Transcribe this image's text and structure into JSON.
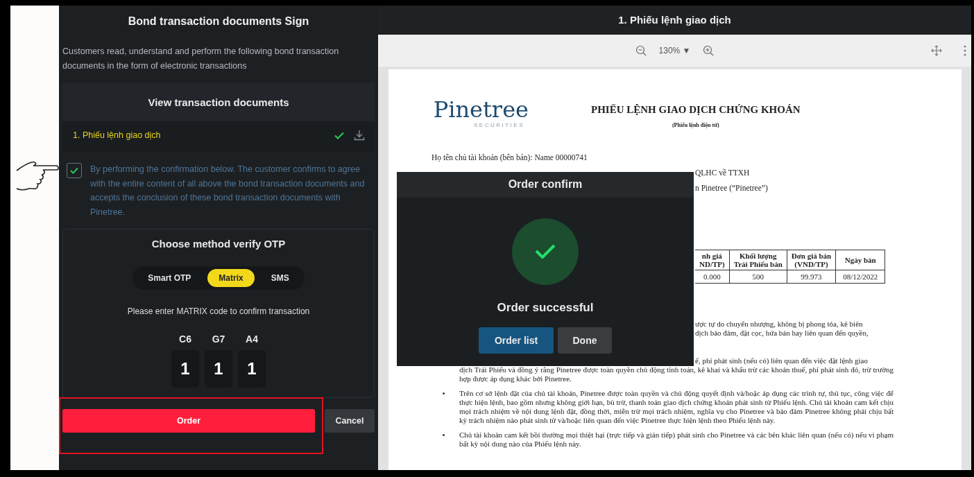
{
  "left_panel": {
    "title": "Bond transaction documents Sign",
    "description": "Customers read, understand and perform the following bond transaction documents in the form of electronic transactions",
    "documents": {
      "title": "View transaction documents",
      "items": [
        {
          "label": "1. Phiếu lệnh giao dịch",
          "signed": true
        }
      ]
    },
    "agreement": {
      "checked": true,
      "text": "By performing the confirmation below. The customer confirms to agree with the entire content of all above the bond transaction documents and accepts the conclusion of these bond transaction documents with Pinetree."
    },
    "otp": {
      "title": "Choose method verify OTP",
      "methods": [
        {
          "label": "Smart OTP",
          "selected": false
        },
        {
          "label": "Matrix",
          "selected": true
        },
        {
          "label": "SMS",
          "selected": false
        }
      ],
      "instruction": "Please enter MATRIX code to confirm transaction",
      "matrix": [
        {
          "code": "C6",
          "value": "1"
        },
        {
          "code": "G7",
          "value": "1"
        },
        {
          "code": "A4",
          "value": "1"
        }
      ]
    },
    "buttons": [
      {
        "label": "Order",
        "kind": "primary"
      },
      {
        "label": "Cancel",
        "kind": "secondary"
      }
    ]
  },
  "viewer": {
    "title": "1. Phiếu lệnh giao dịch",
    "zoom": "130% ▼",
    "document": {
      "logo": "Pinetree",
      "logo_sub": "SECURITIES",
      "heading": "PHIẾU LỆNH GIAO DỊCH CHỨNG KHOÁN",
      "subheading": "(Phiếu lệnh điện tử)",
      "owner_line": "Họ tên chủ tài khoản (bên bán): Name 00000741",
      "top_fragments": [
        "QLHC về TTXH",
        "n Pinetree (“Pinetree”)"
      ],
      "table": {
        "columns": [
          "nh giá\nND/TP)",
          "Khối lượng\nTrái Phiếu bán",
          "Đơn giá bán\n(VND/TP)",
          "Ngày bán"
        ],
        "rows": [
          [
            "0.000",
            "500",
            "99.973",
            "08/12/2022"
          ]
        ]
      },
      "fragments": [
        [
          "ược tự do chuyển nhượng, không bị phong tỏa, kê biên",
          "dịch bảo đảm, đặt cọc, hứa bán hay liên quan đến quyền,"
        ],
        [
          "ế, phí phát sinh (nếu có) liên quan đến việc đặt lệnh giao"
        ]
      ],
      "continuation": "dịch Trái Phiếu và đồng ý rằng Pinetree được toàn quyền chủ động tính toán, kê khai và khấu trừ các khoản thuế, phí phát sinh đó, trừ trường hợp được áp dụng khác bởi Pinetree.",
      "bullets": [
        "Trên cơ sở lệnh đặt của chủ tài khoản, Pinetree được toàn quyền và chủ động quyết định và/hoặc áp dụng các trình tự, thủ tục, công việc để thực hiện lệnh, bao gồm nhưng không giới hạn, bù trừ, thanh toán giao dịch chứng khoán phát sinh từ Phiếu lệnh. Chủ tài khoản cam kết chịu mọi trách nhiệm về nội dung lệnh đặt, đồng thời, miễn trừ mọi trách nhiệm, nghĩa vụ cho Pinetree và bảo đảm Pinetree không phải chịu bất kỳ trách nhiệm nào phát sinh từ và/hoặc liên quan đến việc Pinetree thực hiện lệnh theo Phiếu lệnh này.",
        "Chủ tài khoản cam kết bồi thường mọi thiệt hại (trực tiếp và gián tiếp) phát sinh cho Pinetree và các bên khác liên quan (nếu có) nếu vi phạm bất kỳ nội dung nào của Phiếu lệnh này."
      ]
    }
  },
  "modal": {
    "title": "Order confirm",
    "message": "Order successful",
    "buttons": [
      {
        "label": "Order list",
        "kind": "primary"
      },
      {
        "label": "Done",
        "kind": "secondary"
      }
    ]
  }
}
